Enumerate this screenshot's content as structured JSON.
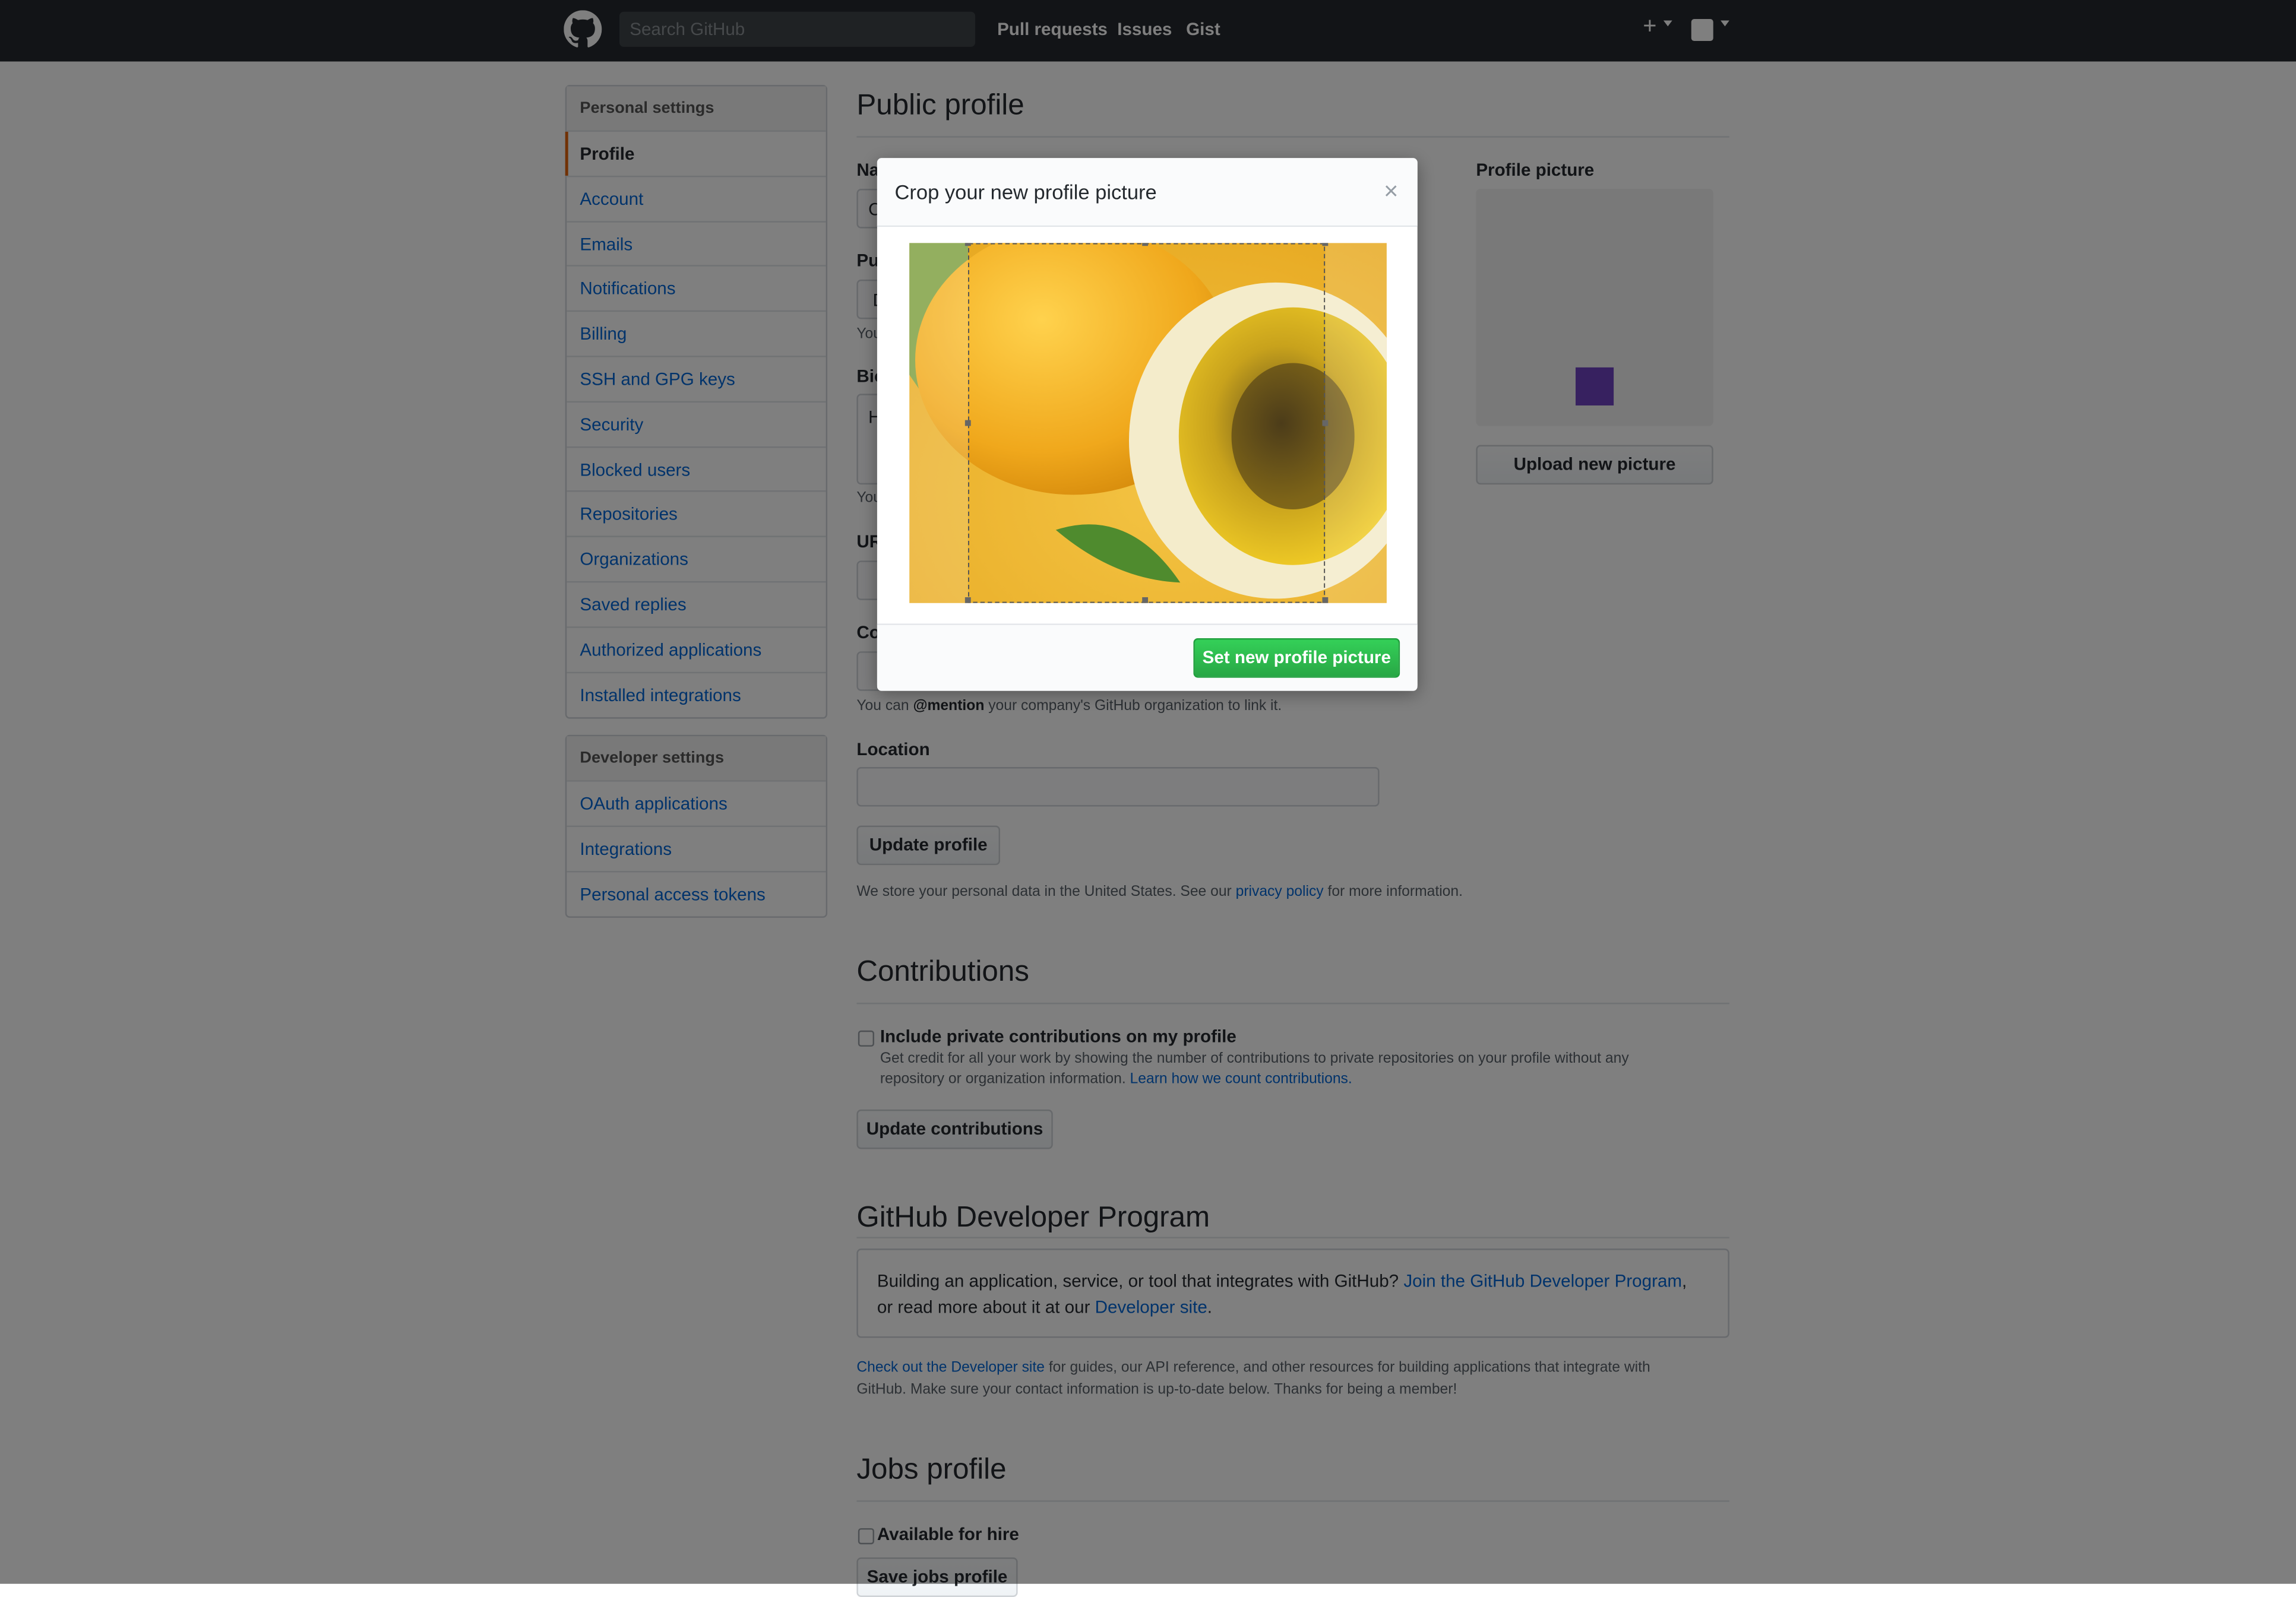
{
  "header": {
    "search_placeholder": "Search GitHub",
    "nav": [
      "Pull requests",
      "Issues",
      "Gist"
    ],
    "plus_label": "+",
    "logo_icon": "github-octocat-icon"
  },
  "sidebar": {
    "personal_heading": "Personal settings",
    "personal_items": [
      {
        "label": "Profile",
        "selected": true
      },
      {
        "label": "Account"
      },
      {
        "label": "Emails"
      },
      {
        "label": "Notifications"
      },
      {
        "label": "Billing"
      },
      {
        "label": "SSH and GPG keys"
      },
      {
        "label": "Security"
      },
      {
        "label": "Blocked users"
      },
      {
        "label": "Repositories"
      },
      {
        "label": "Organizations"
      },
      {
        "label": "Saved replies"
      },
      {
        "label": "Authorized applications"
      },
      {
        "label": "Installed integrations"
      }
    ],
    "developer_heading": "Developer settings",
    "developer_items": [
      {
        "label": "OAuth applications"
      },
      {
        "label": "Integrations"
      },
      {
        "label": "Personal access tokens"
      }
    ]
  },
  "profile": {
    "title": "Public profile",
    "name_label_partial": "Na",
    "public_email_label_partial": "Pu",
    "bio_label_partial": "Bio",
    "url_label_partial": "UR",
    "company_label_partial": "Co",
    "note_partial": "You",
    "name_value_partial": "C",
    "email_value_partial": "D",
    "bio_value_partial": "H",
    "company_note_prefix": "You can ",
    "company_note_mention": "@mention",
    "company_note_suffix": " your company's GitHub organization to link it.",
    "location_label": "Location",
    "update_button": "Update profile",
    "privacy_prefix": "We store your personal data in the United States. See our ",
    "privacy_link": "privacy policy",
    "privacy_suffix": " for more information.",
    "picture_label": "Profile picture",
    "upload_button": "Upload new picture",
    "avatar_color": "#6f42c1"
  },
  "contributions": {
    "title": "Contributions",
    "checkbox_label": "Include private contributions on my profile",
    "description_line1": "Get credit for all your work by showing the number of contributions to private repositories on your profile without any",
    "description_line2_prefix": "repository or organization information. ",
    "description_link": "Learn how we count contributions.",
    "button": "Update contributions"
  },
  "developer_program": {
    "title": "GitHub Developer Program",
    "box_line1_prefix": "Building an application, service, or tool that integrates with GitHub? ",
    "box_line1_link": "Join the GitHub Developer Program",
    "box_line1_suffix": ",",
    "box_line2_prefix": "or read more about it at our ",
    "box_line2_link": "Developer site",
    "box_line2_suffix": ".",
    "note_link": "Check out the Developer site",
    "note_line1_suffix": " for guides, our API reference, and other resources for building applications that integrate with",
    "note_line2": "GitHub. Make sure your contact information is up-to-date below. Thanks for being a member!"
  },
  "jobs": {
    "title": "Jobs profile",
    "checkbox_label": "Available for hire",
    "button": "Save jobs profile"
  },
  "modal": {
    "title": "Crop your new profile picture",
    "close": "×",
    "confirm_button": "Set new profile picture",
    "primary_color": "#28a745"
  }
}
